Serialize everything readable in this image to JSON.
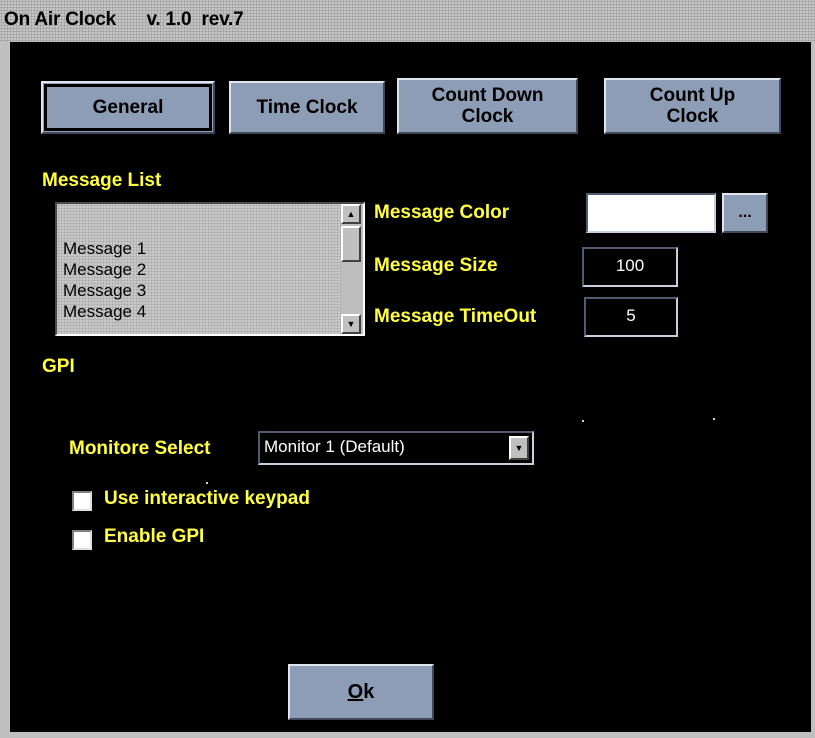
{
  "window": {
    "title": "On Air Clock      v. 1.0  rev.7"
  },
  "tabs": [
    {
      "label": "General",
      "active": true
    },
    {
      "label": "Time Clock",
      "active": false
    },
    {
      "label": "Count Down\nClock",
      "active": false
    },
    {
      "label": "Count Up\nClock",
      "active": false
    }
  ],
  "message_list": {
    "label": "Message List",
    "items": [
      "Message 1",
      "Message 2",
      "Message 3",
      "Message 4"
    ]
  },
  "message_color": {
    "label": "Message Color",
    "value": "#ffffff",
    "browse_label": "..."
  },
  "message_size": {
    "label": "Message Size",
    "value": "100"
  },
  "message_timeout": {
    "label": "Message TimeOut",
    "value": "5"
  },
  "gpi_label": "GPI",
  "monitor_select": {
    "label": "Monitore Select",
    "value": "Monitor 1 (Default)"
  },
  "checkboxes": [
    {
      "label": "Use interactive keypad",
      "checked": false
    },
    {
      "label": "Enable GPI",
      "checked": false
    }
  ],
  "ok_button": {
    "underlined": "O",
    "rest": "k"
  },
  "colors": {
    "accent_label": "#ffff40",
    "button_face": "#8d9db6",
    "background": "#000000"
  }
}
